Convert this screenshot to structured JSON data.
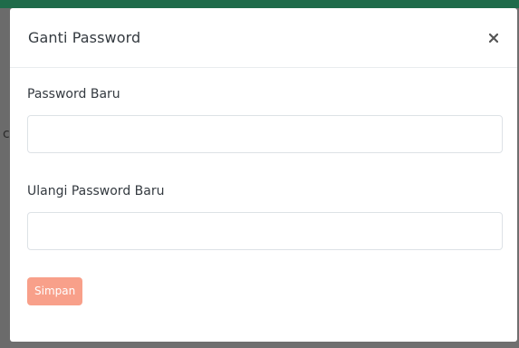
{
  "modal": {
    "title": "Ganti Password",
    "close_icon": "close-icon",
    "fields": [
      {
        "label": "Password Baru",
        "value": "",
        "placeholder": ""
      },
      {
        "label": "Ulangi Password Baru",
        "value": "",
        "placeholder": ""
      }
    ],
    "submit_label": "Simpan"
  },
  "background": {
    "peek_text": "c"
  },
  "colors": {
    "accent_green": "#1f6b4a",
    "submit_button": "#f8a08a",
    "overlay": "#6f6f6f"
  }
}
